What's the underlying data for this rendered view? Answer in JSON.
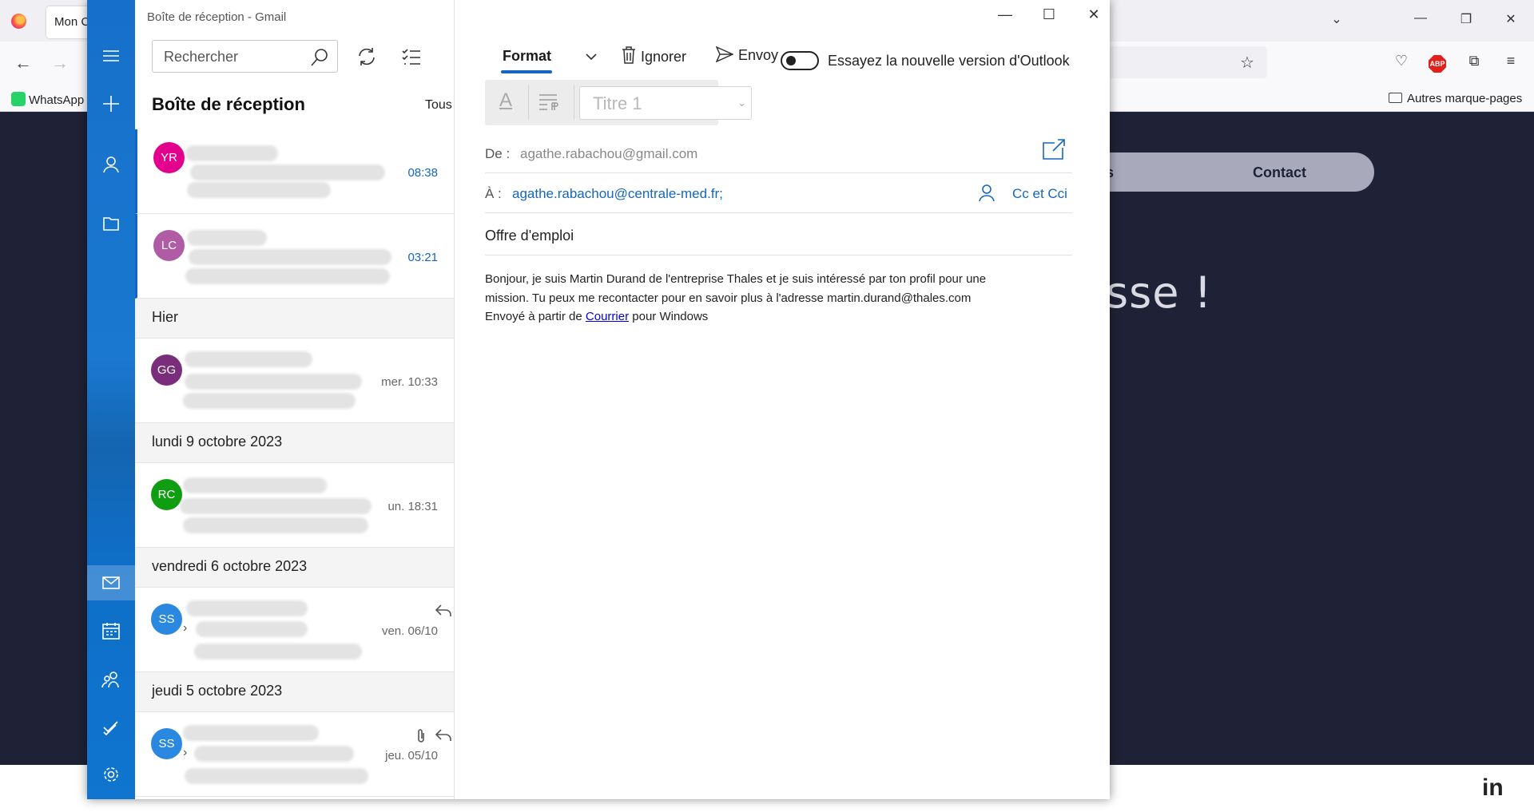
{
  "browser": {
    "tab_title": "Mon C",
    "bookmark_whatsapp": "WhatsApp",
    "bookmark_other": "Autres marque-pages",
    "abp_label": "ABP",
    "icons": [
      "firefox-logo",
      "back-arrow",
      "forward-arrow",
      "star",
      "pocket",
      "adblock",
      "extensions",
      "menu"
    ]
  },
  "website": {
    "nav_partial": "s",
    "nav_contact": "Contact",
    "hero_partial": "sse !",
    "footer_icon": "in"
  },
  "mail": {
    "window_title": "Boîte de réception - Gmail",
    "search_placeholder": "Rechercher",
    "folder_title": "Boîte de réception",
    "filter": "Tous",
    "rail_icons": [
      "menu-icon",
      "compose-icon",
      "accounts-icon",
      "folders-icon",
      "mail-icon",
      "calendar-icon",
      "people-icon",
      "todo-icon",
      "settings-icon"
    ],
    "messages": [
      {
        "initials": "YR",
        "color": "#e3008c",
        "time": "08:38",
        "unread": true
      },
      {
        "initials": "LC",
        "color": "#b05ca5",
        "time": "03:21",
        "unread": true
      },
      {
        "initials": "GG",
        "color": "#7a2d7a",
        "time": "mer. 10:33",
        "unread": false
      },
      {
        "initials": "RC",
        "color": "#0f9d11",
        "time": "un. 18:31",
        "unread": false
      },
      {
        "initials": "SS",
        "color": "#2b88e0",
        "time": "ven. 06/10",
        "unread": false
      },
      {
        "initials": "SS",
        "color": "#2b88e0",
        "time": "jeu. 05/10",
        "unread": false
      }
    ],
    "groups": [
      "Hier",
      "lundi 9 octobre 2023",
      "vendredi 6 octobre 2023",
      "jeudi 5 octobre 2023"
    ]
  },
  "compose": {
    "tab_format": "Format",
    "ignore_label": "Ignorer",
    "send_label": "Envoy",
    "toggle_label": "Essayez la nouvelle version d'Outlook",
    "style_placeholder": "Titre 1",
    "from_label": "De :",
    "from_value": "agathe.rabachou@gmail.com",
    "to_label": "À :",
    "to_value": "agathe.rabachou@centrale-med.fr;",
    "cc_label": "Cc et Cci",
    "subject": "Offre d'emploi",
    "body_line1": "Bonjour, je suis Martin Durand de l'entreprise Thales et je suis intéressé par ton profil pour une",
    "body_line2": "mission. Tu peux me recontacter pour en savoir plus à l'adresse martin.durand@thales.com",
    "body_sent_prefix": "Envoyé à partir de ",
    "body_link": "Courrier",
    "body_sent_suffix": " pour Windows"
  }
}
